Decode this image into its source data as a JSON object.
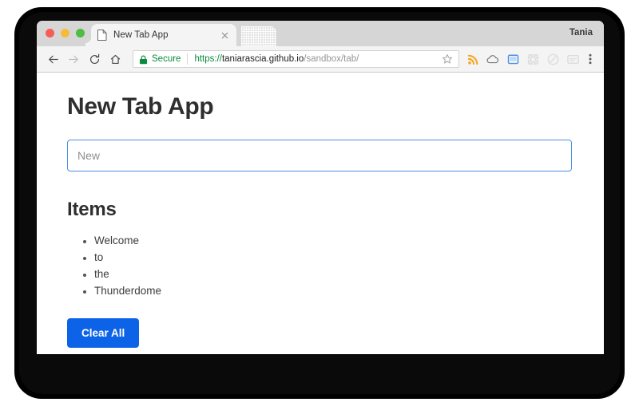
{
  "browser": {
    "window_controls": [
      {
        "name": "close",
        "color": "#f75d55"
      },
      {
        "name": "minimize",
        "color": "#f6bb3d"
      },
      {
        "name": "maximize",
        "color": "#4fbc43"
      }
    ],
    "tab": {
      "title": "New Tab App",
      "favicon": "document-icon",
      "close_label": "×"
    },
    "new_tab_button": "new-tab-button",
    "profile_name": "Tania",
    "nav": {
      "back": "back-arrow-icon",
      "forward": "forward-arrow-icon",
      "reload": "reload-icon",
      "home": "home-icon"
    },
    "omnibox": {
      "lock_icon": "lock-icon",
      "security_label": "Secure",
      "url_scheme": "https://",
      "url_host": "taniarascia.github.io",
      "url_path": "/sandbox/tab/",
      "full_url": "https://taniarascia.github.io/sandbox/tab/",
      "bookmark_icon": "star-icon"
    },
    "extensions": [
      {
        "name": "rss-icon",
        "color": "#f5a623"
      },
      {
        "name": "cloud-icon",
        "color": "#6b6b6b"
      },
      {
        "name": "screen-icon",
        "color": "#4a90e2"
      },
      {
        "name": "gear-icon",
        "color": "#c8c8c8"
      },
      {
        "name": "lens-icon",
        "color": "#c8c8c8"
      },
      {
        "name": "envelope-icon",
        "color": "#c8c8c8"
      }
    ],
    "menu_icon": "three-dot-menu-icon"
  },
  "page": {
    "title": "New Tab App",
    "input": {
      "placeholder": "New",
      "value": ""
    },
    "section_title": "Items",
    "items": [
      "Welcome",
      "to",
      "the",
      "Thunderdome"
    ],
    "clear_button_label": "Clear All",
    "accent_color": "#0c63e7",
    "focus_border_color": "#4a90e2"
  }
}
